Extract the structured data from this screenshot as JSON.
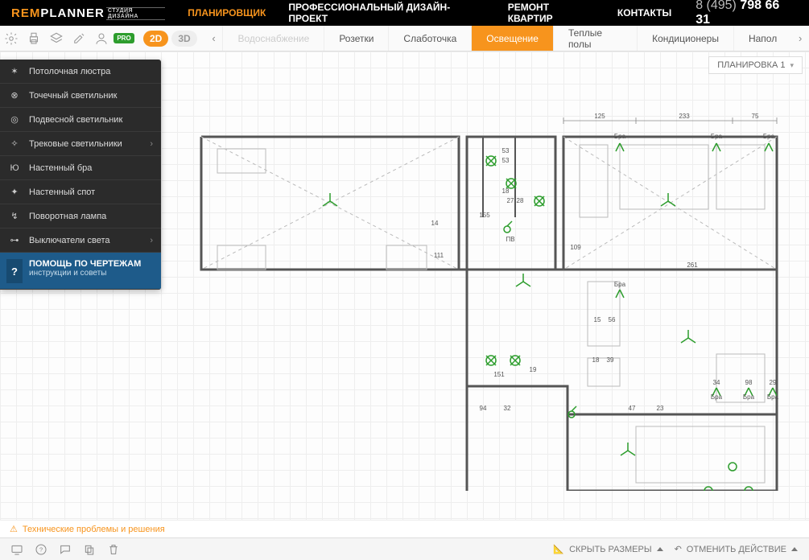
{
  "brand": {
    "rem": "REM",
    "planner": "PLANNER",
    "sub": "СТУДИЯ ДИЗАЙНА"
  },
  "nav": {
    "items": [
      {
        "label": "ПЛАНИРОВЩИК",
        "active": true
      },
      {
        "label": "ПРОФЕССИОНАЛЬНЫЙ ДИЗАЙН-ПРОЕКТ",
        "active": false
      },
      {
        "label": "РЕМОНТ КВАРТИР",
        "active": false
      },
      {
        "label": "КОНТАКТЫ",
        "active": false
      }
    ]
  },
  "phone": {
    "prefix": "8 (495) ",
    "number": "798 66 31"
  },
  "view": {
    "d2": "2D",
    "d3": "3D"
  },
  "tabs": [
    {
      "label": "Водоснабжение",
      "state": "disabled"
    },
    {
      "label": "Розетки",
      "state": ""
    },
    {
      "label": "Слаботочка",
      "state": ""
    },
    {
      "label": "Освещение",
      "state": "active"
    },
    {
      "label": "Теплые полы",
      "state": ""
    },
    {
      "label": "Кондиционеры",
      "state": ""
    },
    {
      "label": "Напол",
      "state": ""
    }
  ],
  "layout_badge": "ПЛАНИРОВКА 1",
  "side_menu": [
    {
      "label": "Потолочная люстра",
      "icon": "chandelier",
      "expand": false
    },
    {
      "label": "Точечный светильник",
      "icon": "spot",
      "expand": false
    },
    {
      "label": "Подвесной светильник",
      "icon": "pendant",
      "expand": false
    },
    {
      "label": "Трековые светильники",
      "icon": "track",
      "expand": true
    },
    {
      "label": "Настенный бра",
      "icon": "bra",
      "expand": false
    },
    {
      "label": "Настенный спот",
      "icon": "wall-spot",
      "expand": false
    },
    {
      "label": "Поворотная лампа",
      "icon": "rot-lamp",
      "expand": false
    },
    {
      "label": "Выключатели света",
      "icon": "switch",
      "expand": true
    }
  ],
  "side_help": {
    "title": "ПОМОЩЬ ПО ЧЕРТЕЖАМ",
    "sub": "инструкции и советы",
    "q": "?"
  },
  "plan_dims": {
    "top": [
      "125",
      "233",
      "75"
    ],
    "inner": [
      "53",
      "53",
      "18",
      "27",
      "28",
      "155",
      "109",
      "14",
      "111",
      "15",
      "56",
      "19",
      "261",
      "151",
      "34",
      "98",
      "29",
      "94",
      "32",
      "18",
      "39",
      "47",
      "23",
      "ПВ",
      "Бра",
      "Бра",
      "Бра",
      "Бра",
      "Бра",
      "Бра",
      "Бра"
    ]
  },
  "issues": {
    "text": "Технические проблемы и решения"
  },
  "bottom": {
    "hide_dims": "СКРЫТЬ РАЗМЕРЫ",
    "undo": "ОТМЕНИТЬ ДЕЙСТВИЕ"
  }
}
